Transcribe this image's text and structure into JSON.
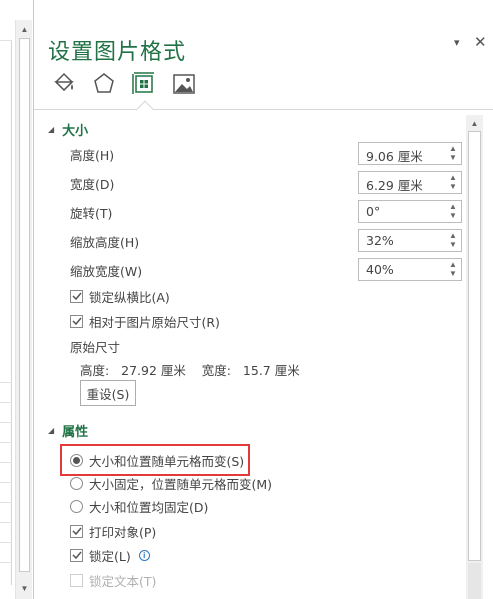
{
  "pane": {
    "title": "设置图片格式",
    "options_icon": "▾",
    "close_icon": "✕",
    "tabs": [
      {
        "name": "fill-line-icon",
        "active": false
      },
      {
        "name": "effects-icon",
        "active": false
      },
      {
        "name": "size-properties-icon",
        "active": true
      },
      {
        "name": "picture-icon",
        "active": false
      }
    ]
  },
  "size_section": {
    "header": "大小",
    "fields": [
      {
        "label": "高度(H)",
        "value": "9.06 厘米"
      },
      {
        "label": "宽度(D)",
        "value": "6.29 厘米"
      },
      {
        "label": "旋转(T)",
        "value": "0°"
      },
      {
        "label": "缩放高度(H)",
        "value": "32%"
      },
      {
        "label": "缩放宽度(W)",
        "value": "40%"
      }
    ],
    "lock_aspect": {
      "label": "锁定纵横比(A)",
      "checked": true
    },
    "relative_original": {
      "label": "相对于图片原始尺寸(R)",
      "checked": true
    },
    "original_size_title": "原始尺寸",
    "original_size_values": "高度:   27.92 厘米    宽度:   15.7 厘米",
    "reset_label": "重设(S)"
  },
  "properties_section": {
    "header": "属性",
    "radios": [
      {
        "label": "大小和位置随单元格而变(S)",
        "selected": true
      },
      {
        "label": "大小固定，位置随单元格而变(M)",
        "selected": false
      },
      {
        "label": "大小和位置均固定(D)",
        "selected": false
      }
    ],
    "print_object": {
      "label": "打印对象(P)",
      "checked": true
    },
    "locked": {
      "label": "锁定(L)",
      "checked": true
    },
    "lock_text": {
      "label": "锁定文本(T)",
      "checked": false,
      "disabled": true
    }
  },
  "colors": {
    "accent": "#217346",
    "highlight": "#e03a3a"
  }
}
